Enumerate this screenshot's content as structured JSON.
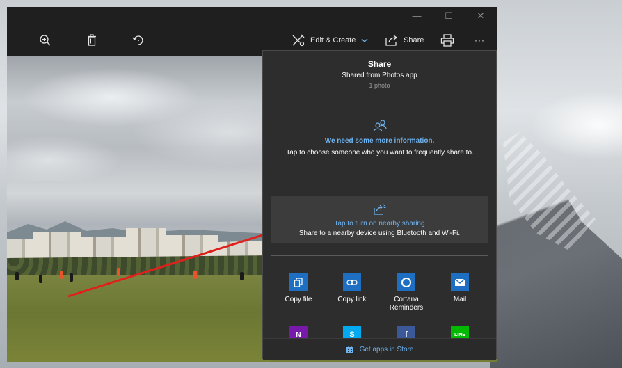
{
  "window": {
    "controls": {
      "minimize": "—",
      "maximize": "☐",
      "close": "✕"
    }
  },
  "toolbar": {
    "zoom_icon": "zoom-in-icon",
    "delete_icon": "trash-icon",
    "rotate_icon": "rotate-icon",
    "edit_create_label": "Edit & Create",
    "share_label": "Share",
    "print_icon": "print-icon",
    "more_label": "···"
  },
  "share": {
    "title": "Share",
    "subtitle": "Shared from Photos app",
    "count": "1 photo",
    "info_title": "We need some more information.",
    "info_body": "Tap to choose someone who you want to frequently share to.",
    "nearby_title": "Tap to turn on nearby sharing",
    "nearby_body": "Share to a nearby device using Bluetooth and Wi-Fi.",
    "apps": [
      {
        "label": "Copy file",
        "color": "#1e6fc1",
        "icon": "copy-file-icon"
      },
      {
        "label": "Copy link",
        "color": "#1e6fc1",
        "icon": "link-icon"
      },
      {
        "label": "Cortana Reminders",
        "color": "#1e6fc1",
        "icon": "cortana-icon"
      },
      {
        "label": "Mail",
        "color": "#1e6fc1",
        "icon": "mail-icon"
      },
      {
        "label": "",
        "color": "#7719aa",
        "icon": "onenote-icon"
      },
      {
        "label": "",
        "color": "#00a9f0",
        "icon": "skype-icon"
      },
      {
        "label": "",
        "color": "#3b5998",
        "icon": "facebook-icon"
      },
      {
        "label": "",
        "color": "#00b900",
        "icon": "line-icon"
      }
    ],
    "footer_label": "Get apps in Store"
  },
  "colors": {
    "accent": "#6fb3ef",
    "panel": "#2d2d2d",
    "annotation_arrow": "#e0201b"
  }
}
